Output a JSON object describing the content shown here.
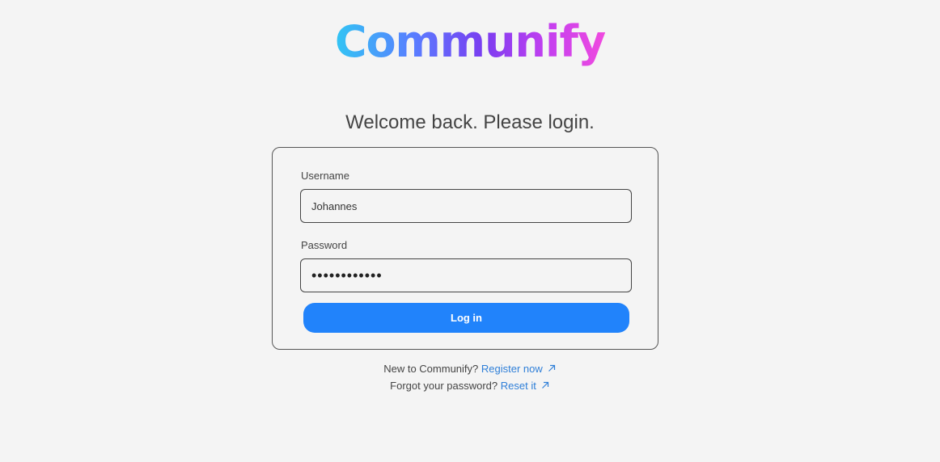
{
  "brand": {
    "logo_text": "Communify",
    "gradient_colors": [
      "#32c5f4",
      "#5a7bff",
      "#7a3df0",
      "#c23ff0",
      "#f04adf"
    ]
  },
  "heading": "Welcome back. Please login.",
  "form": {
    "username_label": "Username",
    "username_value": "Johannes",
    "password_label": "Password",
    "password_value": "••••••••••••",
    "login_label": "Log in",
    "accent_color": "#2183fb"
  },
  "footer": {
    "register_prompt": "New to Communify?",
    "register_link": "Register now",
    "reset_prompt": "Forgot your password?",
    "reset_link": "Reset it",
    "link_icon": "arrow-up-right-icon",
    "link_color": "#2f7fd8"
  }
}
